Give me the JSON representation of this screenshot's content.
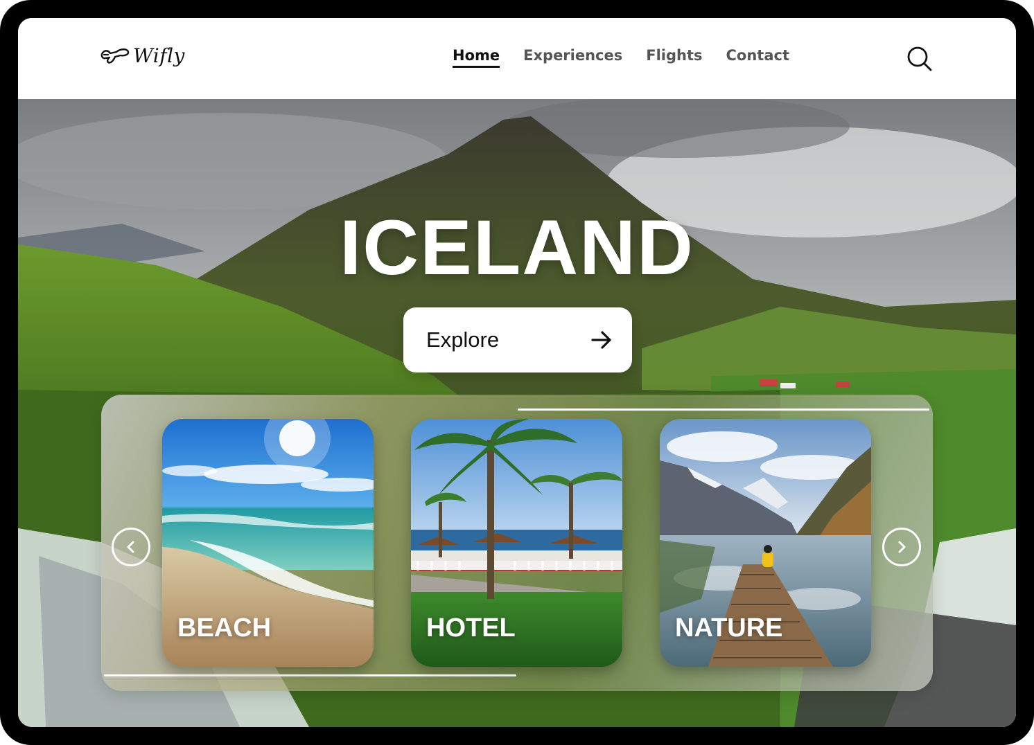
{
  "brand": {
    "name": "Wifly",
    "logo_icon": "plane-logo-icon"
  },
  "nav": {
    "items": [
      {
        "label": "Home",
        "active": true
      },
      {
        "label": "Experiences",
        "active": false
      },
      {
        "label": "Flights",
        "active": false
      },
      {
        "label": "Contact",
        "active": false
      }
    ],
    "search_icon": "search-icon"
  },
  "hero": {
    "title": "ICELAND",
    "explore_label": "Explore",
    "explore_icon": "arrow-right-icon"
  },
  "carousel": {
    "prev_icon": "chevron-left-icon",
    "next_icon": "chevron-right-icon",
    "cards": [
      {
        "label": "BEACH"
      },
      {
        "label": "HOTEL"
      },
      {
        "label": "NATURE"
      }
    ]
  },
  "colors": {
    "text_primary": "#111111",
    "nav_inactive": "#555555",
    "white": "#ffffff",
    "device_frame": "#000000"
  }
}
